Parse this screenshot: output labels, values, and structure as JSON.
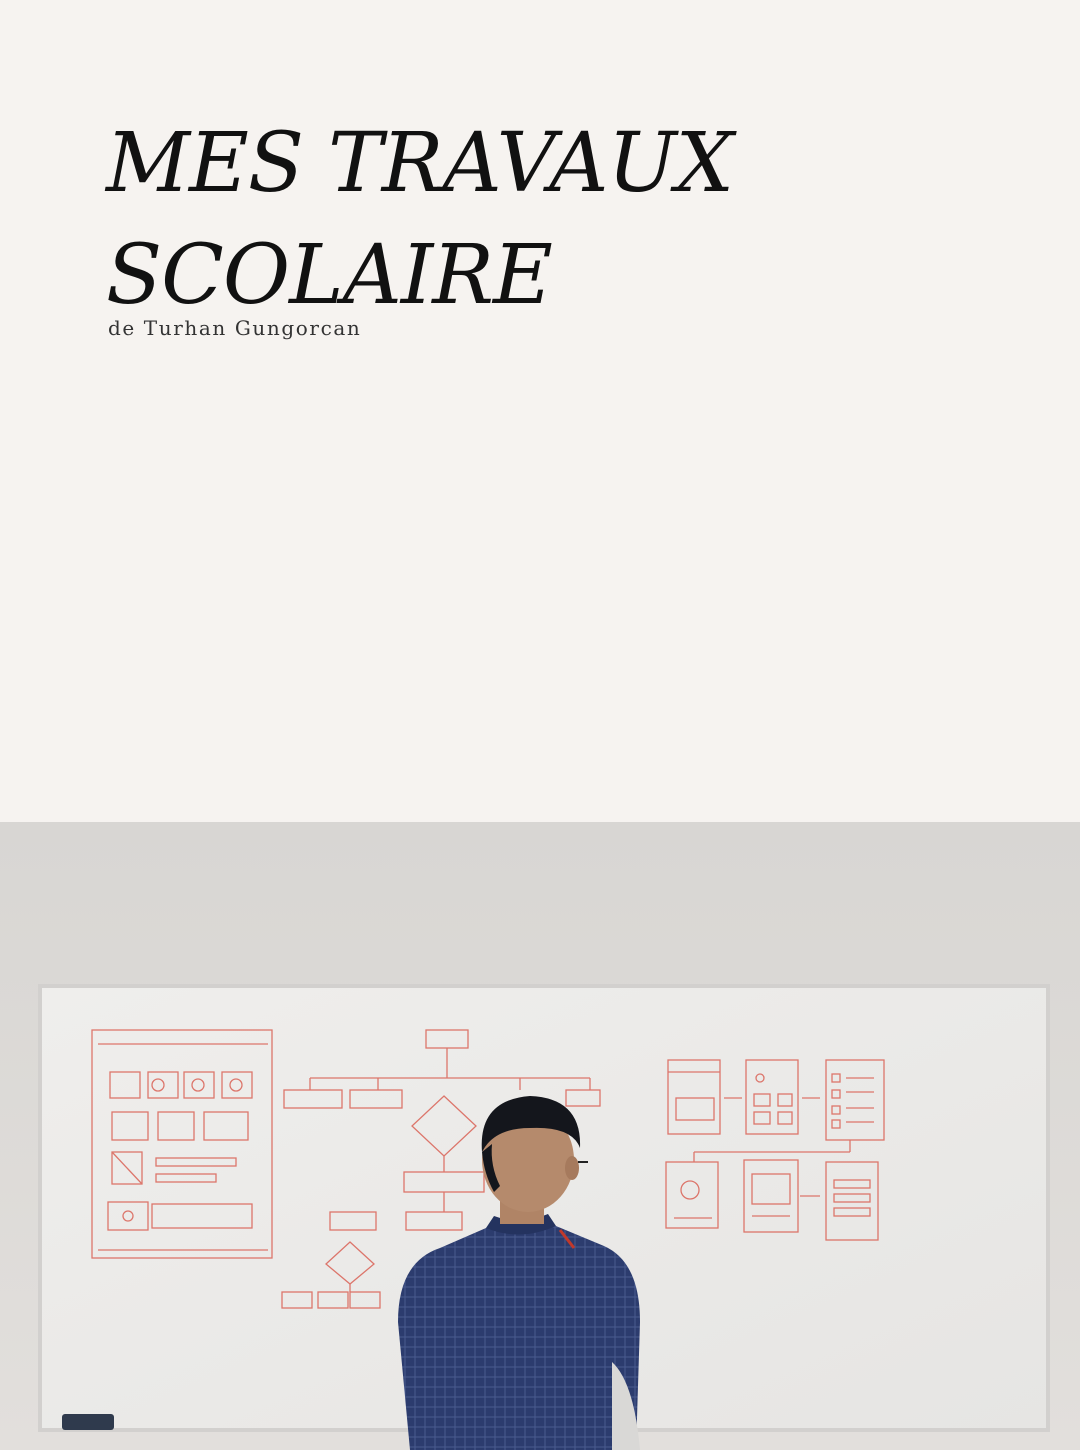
{
  "cover": {
    "title_line1": "MES TRAVAUX",
    "title_line2": "SCOLAIRE",
    "subtitle": "de Turhan Gungorcan"
  },
  "photo": {
    "description_icon": "person-at-whiteboard-photo"
  },
  "colors": {
    "background": "#f6f3f0",
    "text": "#111111",
    "wall": "#dcd9d6",
    "whiteboard": "#ecebea",
    "marker": "#d9594c",
    "shirt": "#2b3a6b"
  }
}
